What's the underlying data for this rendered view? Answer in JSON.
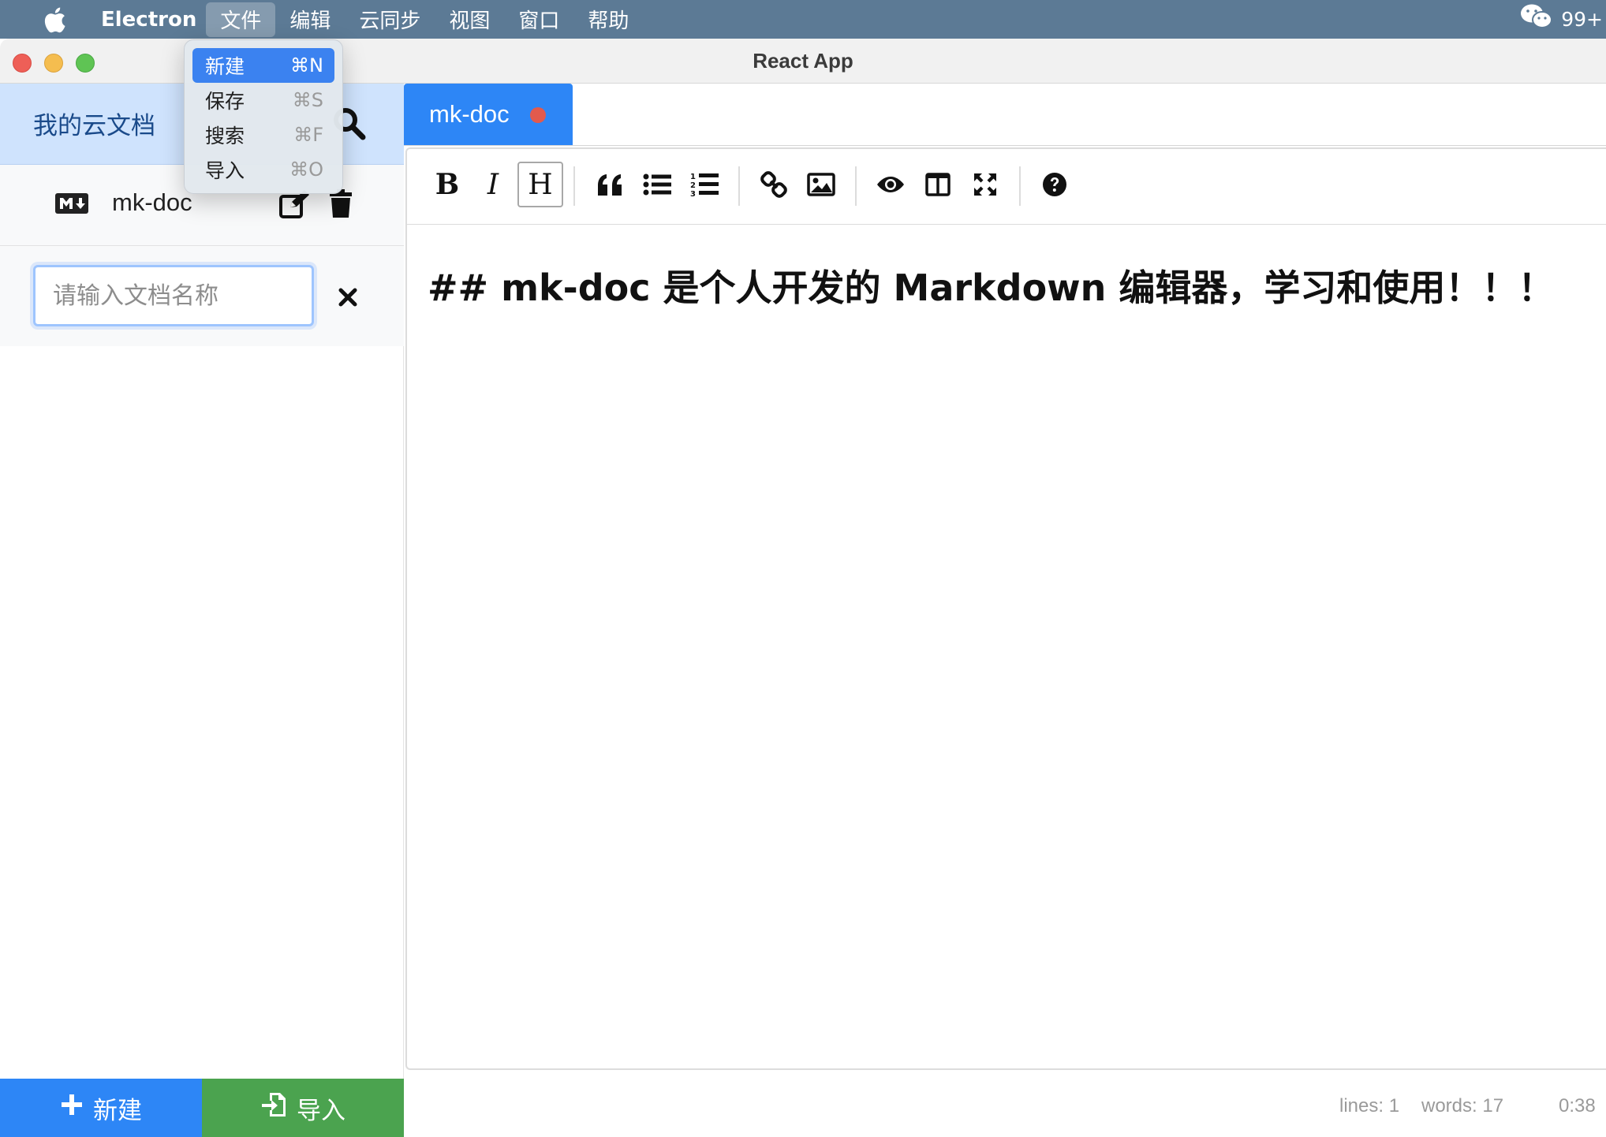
{
  "menubar": {
    "app_name": "Electron",
    "items": [
      "文件",
      "编辑",
      "云同步",
      "视图",
      "窗口",
      "帮助"
    ],
    "active_index": 0,
    "right_badge": "99+"
  },
  "file_menu": {
    "items": [
      {
        "label": "新建",
        "shortcut": "⌘N"
      },
      {
        "label": "保存",
        "shortcut": "⌘S"
      },
      {
        "label": "搜索",
        "shortcut": "⌘F"
      },
      {
        "label": "导入",
        "shortcut": "⌘O"
      }
    ],
    "selected_index": 0
  },
  "window": {
    "title": "React App"
  },
  "sidebar": {
    "title": "我的云文档",
    "files": [
      {
        "name": "mk-doc"
      }
    ],
    "new_file_input": {
      "value": "",
      "placeholder": "请输入文档名称"
    },
    "new_button_label": "新建",
    "import_button_label": "导入"
  },
  "editor": {
    "tabs": [
      {
        "label": "mk-doc",
        "unsaved": true
      }
    ],
    "toolbar": [
      "bold-icon",
      "italic-icon",
      "heading-icon",
      "quote-icon",
      "unordered-list-icon",
      "ordered-list-icon",
      "link-icon",
      "image-icon",
      "preview-icon",
      "side-by-side-icon",
      "fullscreen-icon",
      "help-icon"
    ],
    "toolbar_labels": {
      "bold": "B",
      "italic": "I",
      "heading": "H"
    },
    "content": "## mk-doc 是个人开发的 Markdown 编辑器，学习和使用！！！",
    "status": {
      "lines": "lines: 1",
      "words": "words: 17",
      "time": "0:38"
    }
  },
  "colors": {
    "primary": "#2d86f6",
    "success": "#4ba34f",
    "unsaved_dot": "#e25a4d",
    "menubar": "#5c7a95"
  }
}
